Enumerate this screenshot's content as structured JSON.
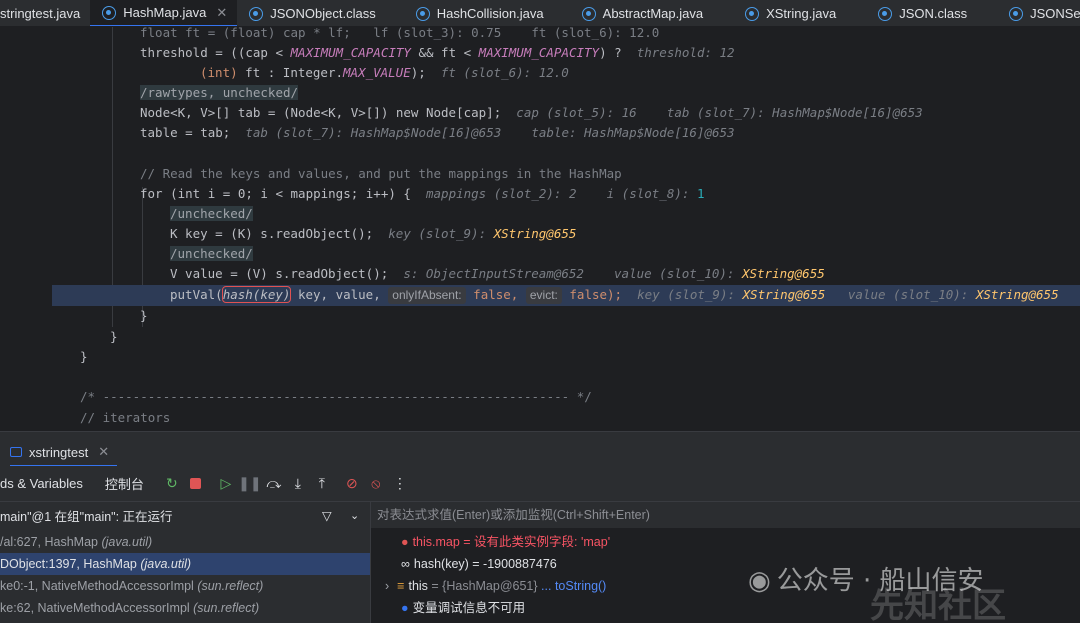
{
  "tabs": [
    {
      "label": "stringtest.java",
      "icon": "java-class-icon",
      "active": false
    },
    {
      "label": "HashMap.java",
      "icon": "java-class-icon",
      "active": true
    },
    {
      "label": "JSONObject.class",
      "icon": "java-class-icon",
      "active": false
    },
    {
      "label": "HashCollision.java",
      "icon": "java-class-icon",
      "active": false
    },
    {
      "label": "AbstractMap.java",
      "icon": "java-class-icon",
      "active": false
    },
    {
      "label": "XString.java",
      "icon": "java-class-icon",
      "active": false
    },
    {
      "label": "JSON.class",
      "icon": "java-class-icon",
      "active": false
    },
    {
      "label": "JSONSerializer",
      "icon": "java-class-icon",
      "active": false
    }
  ],
  "code": {
    "l0": "float ft = (float) cap * lf;   lf (slot_3): 0.75    ft (slot_6): 12.0",
    "l1_a": "threshold = ((cap < ",
    "l1_b": "MAXIMUM_CAPACITY",
    "l1_c": " && ft < ",
    "l1_d": "MAXIMUM_CAPACITY",
    "l1_e": ") ?",
    "l1_hint": "threshold: 12",
    "l2_a": "(int)",
    "l2_b": " ft : Integer.",
    "l2_c": "MAX_VALUE",
    "l2_d": ");",
    "l2_hint": "ft (slot_6): 12.0",
    "l3": "/rawtypes, unchecked/",
    "l4_code": "Node<K, V>[] tab = (Node<K, V>[]) new Node[cap];",
    "l4_hint": "cap (slot_5): 16    tab (slot_7): HashMap$Node[16]@653",
    "l5_code": "table = tab;",
    "l5_hint": "tab (slot_7): HashMap$Node[16]@653    table: HashMap$Node[16]@653",
    "l7": "// Read the keys and values, and put the mappings in the HashMap",
    "l8_code": "for (int i = 0; i < mappings; i++) {",
    "l8_hint": "mappings (slot_2): 2    i (slot_8): ",
    "l8_hint_v": "1",
    "l9": "/unchecked/",
    "l10_code": "K key = (K) s.readObject();",
    "l10_hint": "key (slot_9): ",
    "l10_hint_v": "XString@655",
    "l11": "/unchecked/",
    "l12_code": "V value = (V) s.readObject();",
    "l12_hint": "s: ObjectInputStream@652    value (slot_10): ",
    "l12_hint_v": "XString@655",
    "l13_a": "putVal(",
    "l13_b": "hash(key)",
    "l13_c": " key, value, ",
    "l13_p1": "onlyIfAbsent:",
    "l13_v1": " false, ",
    "l13_p2": "evict:",
    "l13_v2": " false);",
    "l13_hint1": "key (slot_9): ",
    "l13_hint1v": "XString@655",
    "l13_hint2": "value (slot_10): ",
    "l13_hint2v": "XString@655",
    "l14": "}",
    "l15": "}",
    "l16": "}",
    "l18": "/* -------------------------------------------------------------- */",
    "l19": "// iterators"
  },
  "debug": {
    "session_tab": "xstringtest",
    "tab_frames": "ds & Variables",
    "tab_console": "控制台",
    "thread": "main\"@1 在组\"main\": 正在运行",
    "eval_placeholder": "对表达式求值(Enter)或添加监视(Ctrl+Shift+Enter)",
    "frames": [
      {
        "method": "/al:627, HashMap ",
        "pkg": "(java.util)",
        "selected": false
      },
      {
        "method": "DObject:1397, HashMap ",
        "pkg": "(java.util)",
        "selected": true
      },
      {
        "method": "ke0:-1, NativeMethodAccessorImpl ",
        "pkg": "(sun.reflect)",
        "selected": false
      },
      {
        "method": "ke:62, NativeMethodAccessorImpl ",
        "pkg": "(sun.reflect)",
        "selected": false
      }
    ],
    "vars": {
      "v1_name": "this.map",
      "v1_value": " = 设有此类实例字段: 'map'",
      "v2_name": "hash(key)",
      "v2_value": " = -1900887476",
      "v3_name": "this",
      "v3_value": " = {HashMap@651} ",
      "v3_link": "... toString()",
      "v4": "变量调试信息不可用"
    }
  },
  "watermark": {
    "text": "公众号 · 船山信安",
    "text2": "先知社区"
  }
}
